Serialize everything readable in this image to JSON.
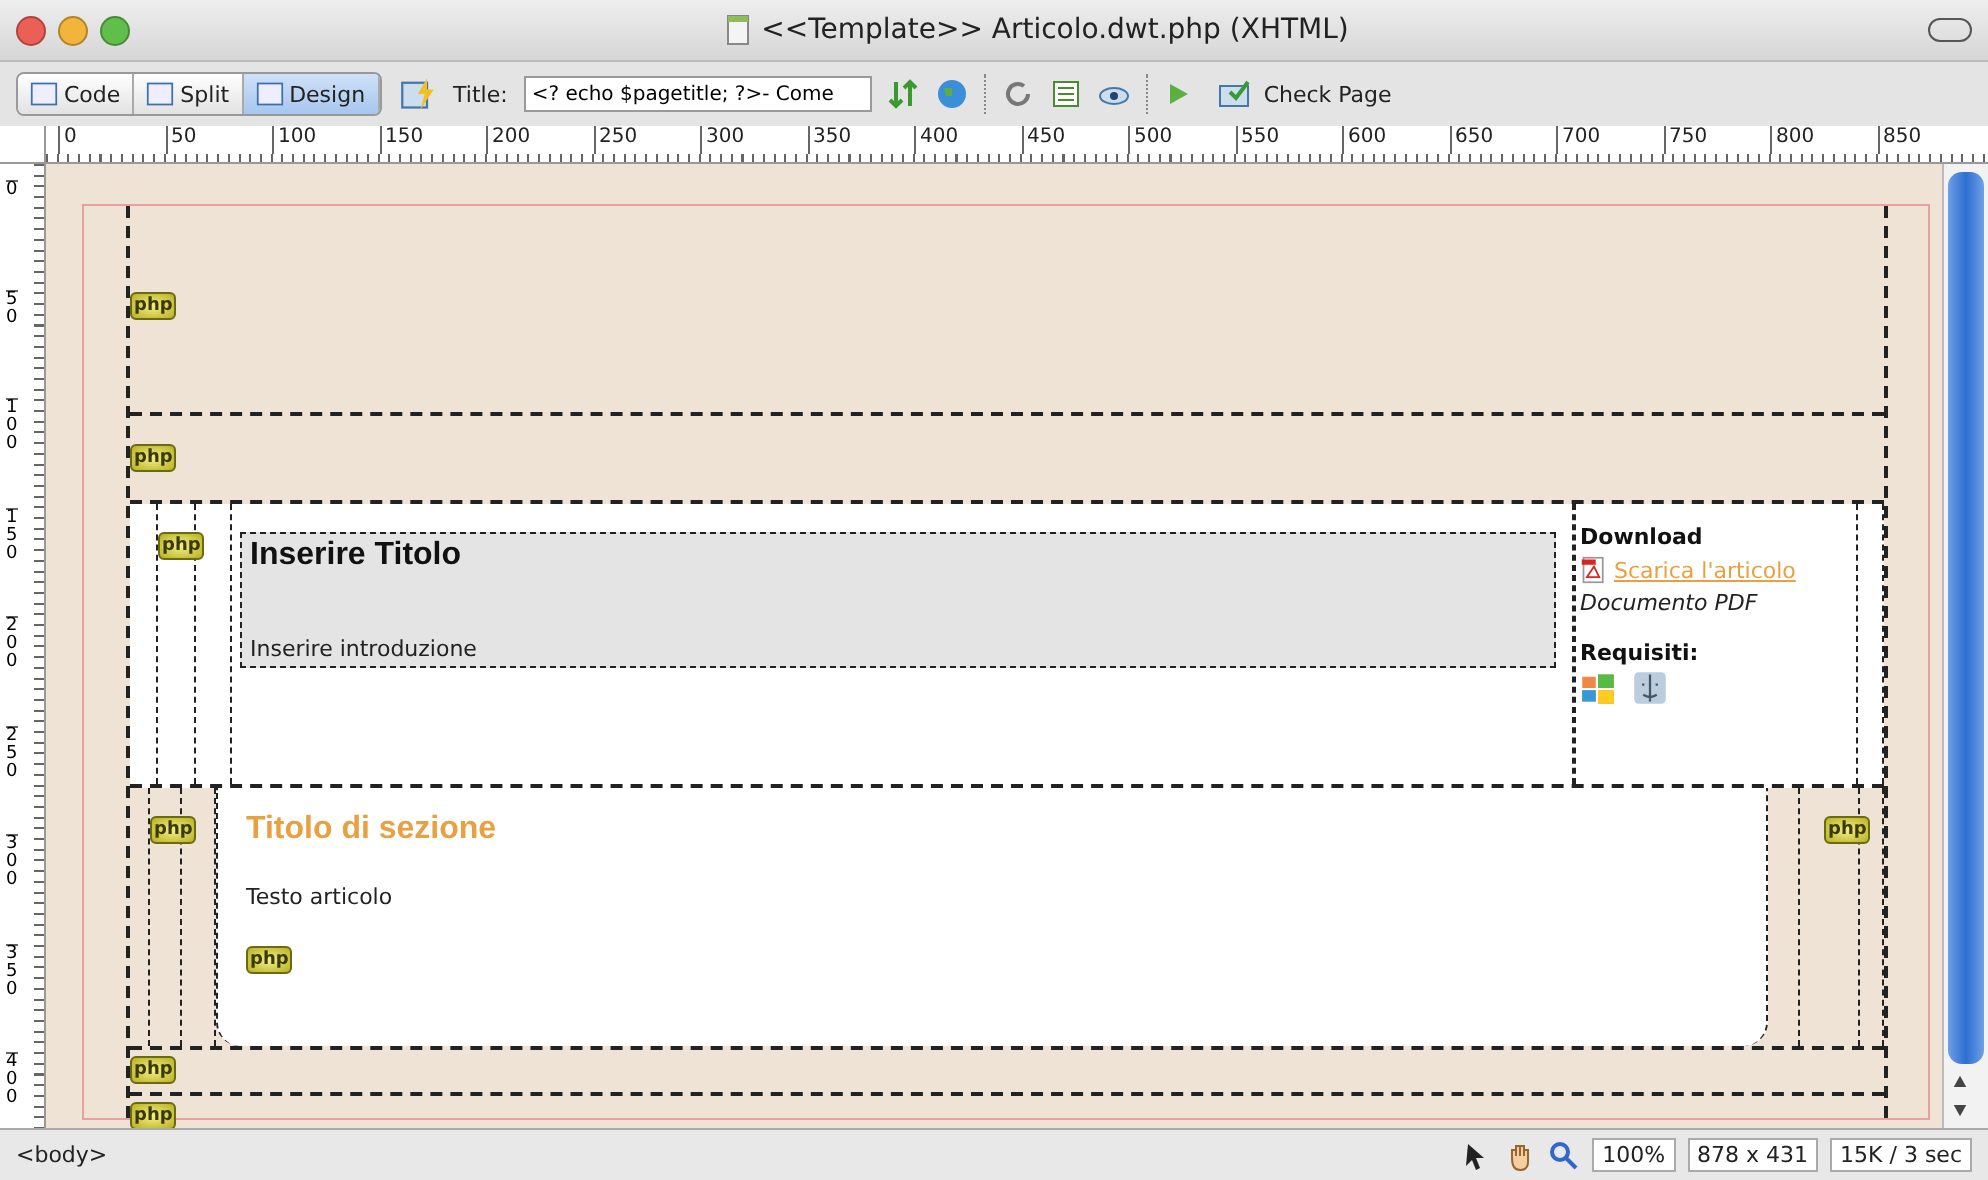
{
  "window": {
    "title": "<<Template>> Articolo.dwt.php (XHTML)"
  },
  "toolbar": {
    "view_buttons": [
      {
        "label": "Code",
        "selected": false
      },
      {
        "label": "Split",
        "selected": false
      },
      {
        "label": "Design",
        "selected": true
      }
    ],
    "title_label": "Title:",
    "title_value": "<? echo $pagetitle; ?>- Come",
    "check_page": "Check Page"
  },
  "rulers": {
    "horizontal": [
      "0",
      "50",
      "100",
      "150",
      "200",
      "250",
      "300",
      "350",
      "400",
      "450",
      "500",
      "550",
      "600",
      "650",
      "700",
      "750",
      "800",
      "850"
    ],
    "vertical": [
      "0",
      "50",
      "100",
      "150",
      "200",
      "250",
      "300",
      "350",
      "400"
    ]
  },
  "page": {
    "header": {
      "marker": "php"
    },
    "nav": {
      "marker": "php"
    },
    "intro": {
      "marker": "php",
      "title": "Inserire Titolo",
      "text": "Inserire introduzione"
    },
    "sidebar": {
      "heading": "Download",
      "link": "Scarica l'articolo",
      "note": "Documento PDF",
      "requirements": "Requisiti:"
    },
    "section": {
      "left_marker": "php",
      "title": "Titolo di sezione",
      "text": "Testo articolo",
      "bottom_marker": "php",
      "right_marker": "php"
    },
    "footer": {
      "markers": [
        "php",
        "php"
      ]
    }
  },
  "status_bar": {
    "tag": "<body>",
    "zoom": "100%",
    "window_size": "878 x 431",
    "download_info": "15K / 3 sec"
  }
}
